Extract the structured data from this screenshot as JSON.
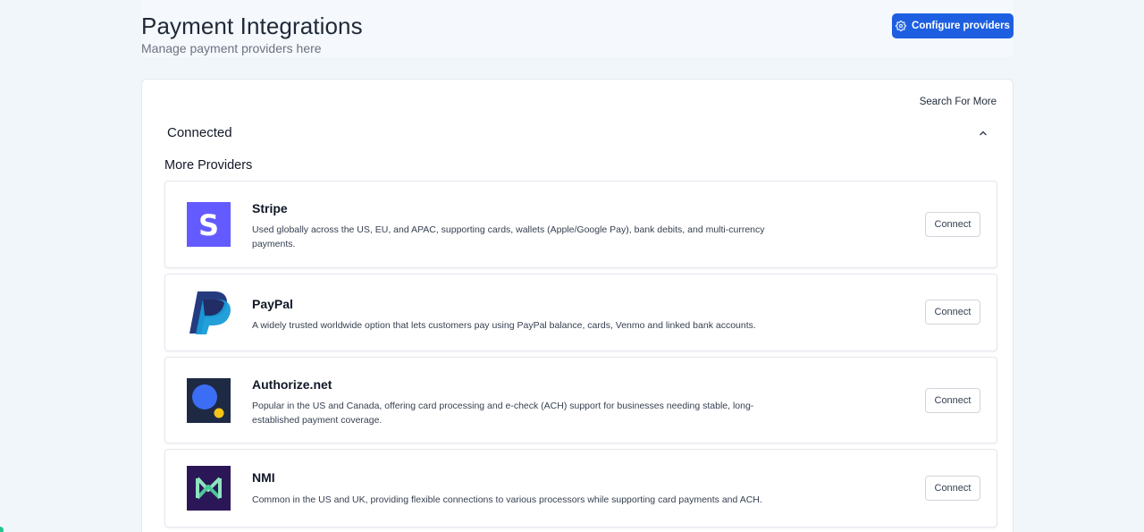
{
  "header": {
    "title": "Payment Integrations",
    "subtitle": "Manage payment providers here",
    "configure_button": "Configure providers",
    "accent_color": "#1d5fe0"
  },
  "panel": {
    "search_link": "Search For More",
    "connected_label": "Connected",
    "more_providers_label": "More Providers"
  },
  "providers": [
    {
      "name": "Stripe",
      "description": "Used globally across the US, EU, and APAC, supporting cards, wallets (Apple/Google Pay), bank debits, and multi-currency payments.",
      "action": "Connect",
      "logo": "stripe-logo",
      "logo_text": "S"
    },
    {
      "name": "PayPal",
      "description": "A widely trusted worldwide option that lets customers pay using PayPal balance, cards, Venmo and linked bank accounts.",
      "action": "Connect",
      "logo": "paypal-logo"
    },
    {
      "name": "Authorize.net",
      "description": "Popular in the US and Canada, offering card processing and e-check (ACH) support for businesses needing stable, long-established payment coverage.",
      "action": "Connect",
      "logo": "authorize-net-logo"
    },
    {
      "name": "NMI",
      "description": "Common in the US and UK, providing flexible connections to various processors while supporting card payments and ACH.",
      "action": "Connect",
      "logo": "nmi-logo"
    }
  ]
}
